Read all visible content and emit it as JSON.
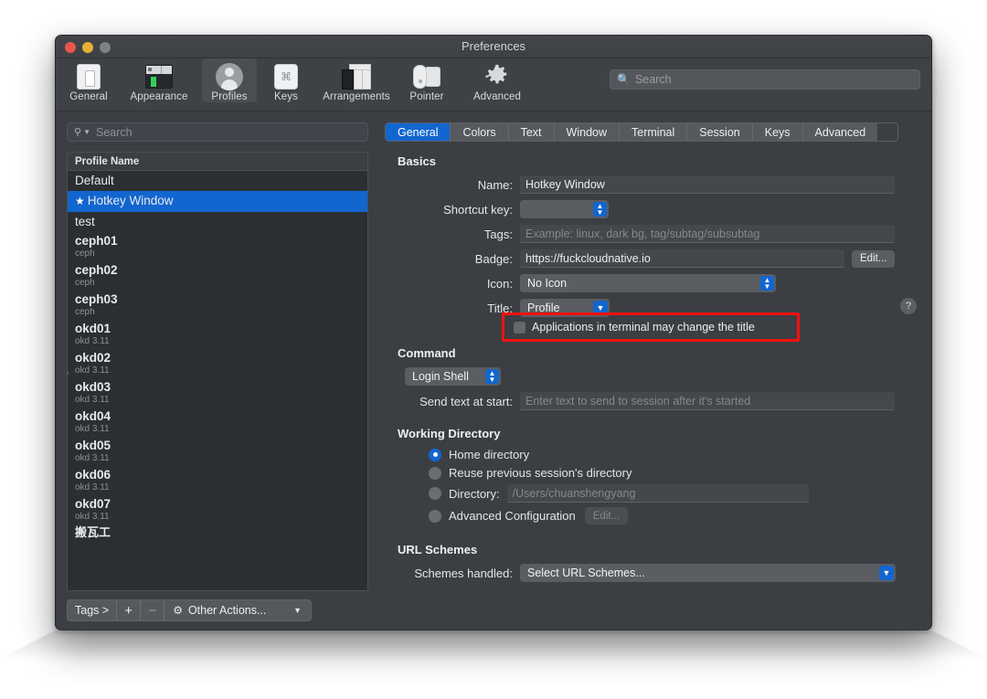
{
  "window": {
    "title": "Preferences",
    "traffic_lights": [
      "close",
      "minimize",
      "zoom"
    ]
  },
  "toolbar": {
    "items": [
      {
        "label": "General",
        "icon": "general-icon",
        "selected": false
      },
      {
        "label": "Appearance",
        "icon": "appearance-icon",
        "selected": false
      },
      {
        "label": "Profiles",
        "icon": "profiles-icon",
        "selected": true
      },
      {
        "label": "Keys",
        "icon": "keys-icon",
        "selected": false
      },
      {
        "label": "Arrangements",
        "icon": "arrangements-icon",
        "selected": false
      },
      {
        "label": "Pointer",
        "icon": "pointer-icon",
        "selected": false
      },
      {
        "label": "Advanced",
        "icon": "gear-icon",
        "selected": false
      }
    ],
    "search": {
      "placeholder": "Search",
      "value": "",
      "icon": "search-icon"
    }
  },
  "sidebar": {
    "search": {
      "placeholder": "Search",
      "value": "",
      "icon": "search-icon"
    },
    "list_header": "Profile Name",
    "profiles": [
      {
        "name": "Default",
        "tag": "",
        "bold": false,
        "selected": false,
        "starred": false
      },
      {
        "name": "Hotkey Window",
        "tag": "",
        "bold": false,
        "selected": true,
        "starred": true
      },
      {
        "name": "test",
        "tag": "",
        "bold": false,
        "selected": false,
        "starred": false
      },
      {
        "name": "ceph01",
        "tag": "ceph",
        "bold": true,
        "selected": false,
        "starred": false
      },
      {
        "name": "ceph02",
        "tag": "ceph",
        "bold": true,
        "selected": false,
        "starred": false
      },
      {
        "name": "ceph03",
        "tag": "ceph",
        "bold": true,
        "selected": false,
        "starred": false
      },
      {
        "name": "okd01",
        "tag": "okd 3.11",
        "bold": true,
        "selected": false,
        "starred": false
      },
      {
        "name": "okd02",
        "tag": "okd 3.11",
        "bold": true,
        "selected": false,
        "starred": false
      },
      {
        "name": "okd03",
        "tag": "okd 3.11",
        "bold": true,
        "selected": false,
        "starred": false
      },
      {
        "name": "okd04",
        "tag": "okd 3.11",
        "bold": true,
        "selected": false,
        "starred": false
      },
      {
        "name": "okd05",
        "tag": "okd 3.11",
        "bold": true,
        "selected": false,
        "starred": false
      },
      {
        "name": "okd06",
        "tag": "okd 3.11",
        "bold": true,
        "selected": false,
        "starred": false
      },
      {
        "name": "okd07",
        "tag": "okd 3.11",
        "bold": true,
        "selected": false,
        "starred": false
      },
      {
        "name": "搬瓦工",
        "tag": "",
        "bold": true,
        "selected": false,
        "starred": false
      }
    ],
    "footer": {
      "tags_label": "Tags >",
      "add_label": "+",
      "remove_label": "−",
      "other_actions_label": "Other Actions...",
      "gear_icon": "gear-icon",
      "chevron_icon": "chevron-down-icon"
    }
  },
  "panel": {
    "tabs": [
      {
        "label": "General",
        "active": true
      },
      {
        "label": "Colors",
        "active": false
      },
      {
        "label": "Text",
        "active": false
      },
      {
        "label": "Window",
        "active": false
      },
      {
        "label": "Terminal",
        "active": false
      },
      {
        "label": "Session",
        "active": false
      },
      {
        "label": "Keys",
        "active": false
      },
      {
        "label": "Advanced",
        "active": false
      }
    ],
    "basics": {
      "title": "Basics",
      "name": {
        "label": "Name:",
        "value": "Hotkey Window"
      },
      "shortcut_key": {
        "label": "Shortcut key:",
        "value": ""
      },
      "tags": {
        "label": "Tags:",
        "value": "",
        "placeholder": "Example: linux, dark bg, tag/subtag/subsubtag"
      },
      "badge": {
        "label": "Badge:",
        "value": "https://fuckcloudnative.io",
        "edit_label": "Edit..."
      },
      "icon": {
        "label": "Icon:",
        "value": "No Icon"
      },
      "title_field": {
        "label": "Title:",
        "value": "Profile"
      },
      "apps_change_title": {
        "label": "Applications in terminal may change the title",
        "checked": false
      },
      "help_label": "?"
    },
    "command": {
      "title": "Command",
      "shell": {
        "value": "Login Shell"
      },
      "send_text": {
        "label": "Send text at start:",
        "value": "",
        "placeholder": "Enter text to send to session after it's started"
      }
    },
    "working_directory": {
      "title": "Working Directory",
      "options": [
        {
          "label": "Home directory",
          "selected": true
        },
        {
          "label": "Reuse previous session's directory",
          "selected": false
        },
        {
          "label": "Directory:",
          "selected": false,
          "value": "",
          "placeholder": "/Users/chuanshengyang"
        },
        {
          "label": "Advanced Configuration",
          "selected": false,
          "button": "Edit..."
        }
      ]
    },
    "url_schemes": {
      "title": "URL Schemes",
      "schemes_handled": {
        "label": "Schemes handled:",
        "value": "Select URL Schemes..."
      }
    }
  },
  "colors": {
    "accent": "#1266cf",
    "highlight_box": "#fa0f0f",
    "window_bg": "#3b3e43",
    "list_bg": "#2b2e33"
  }
}
